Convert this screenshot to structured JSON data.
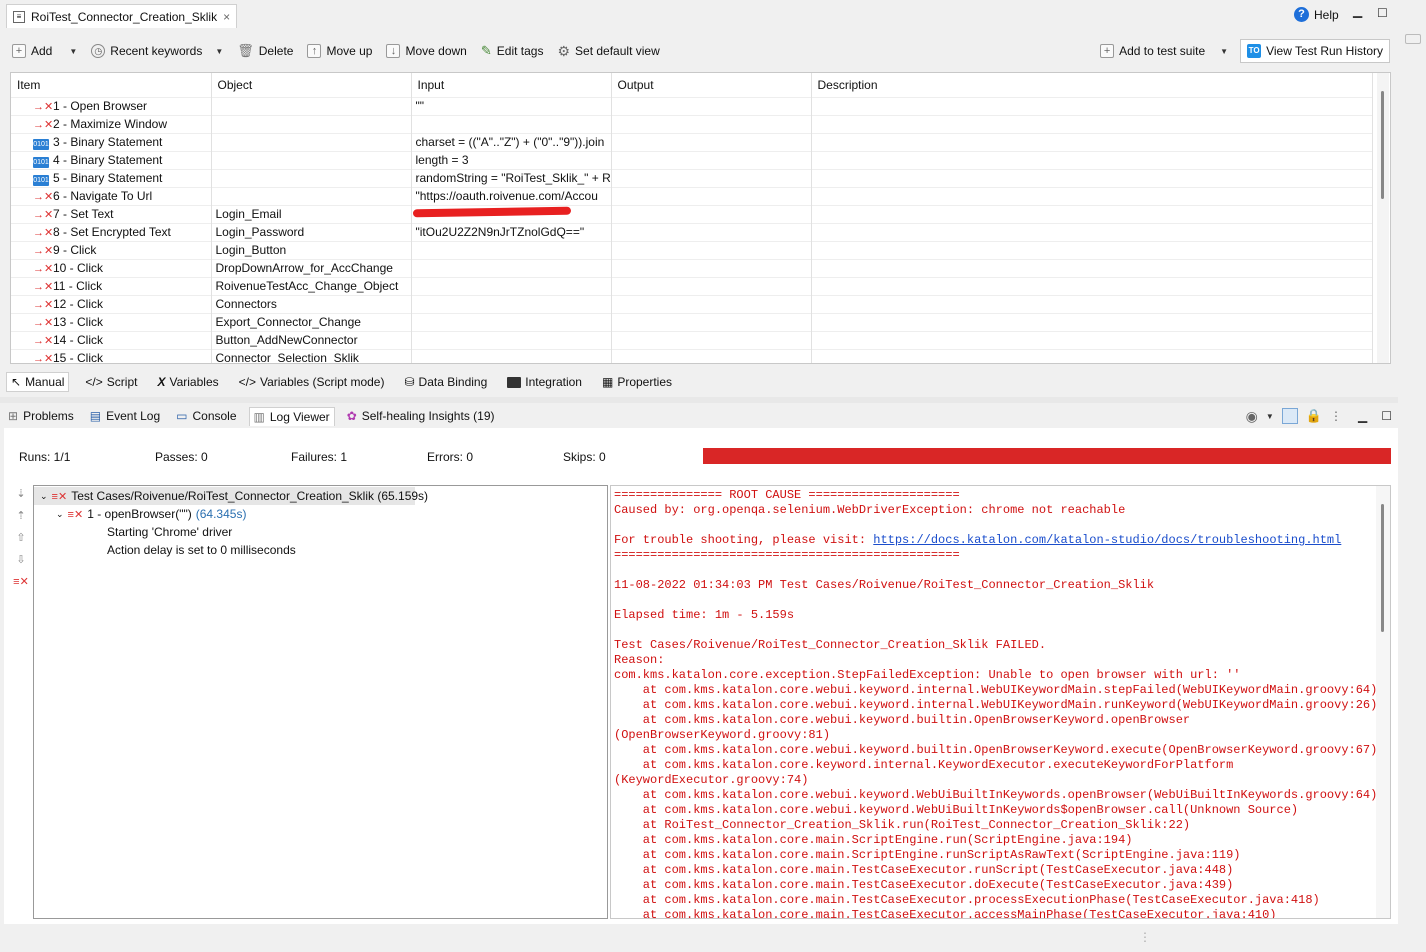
{
  "editor_tab": {
    "title": "RoiTest_Connector_Creation_Sklik",
    "close": "×"
  },
  "help": {
    "label": "Help"
  },
  "toolbar": {
    "add": "Add",
    "recent_keywords": "Recent keywords",
    "delete": "Delete",
    "move_up": "Move up",
    "move_down": "Move down",
    "edit_tags": "Edit tags",
    "set_default_view": "Set default view",
    "add_to_test_suite": "Add to test suite",
    "view_history": "View Test Run History"
  },
  "grid": {
    "headers": {
      "item": "Item",
      "object": "Object",
      "input": "Input",
      "output": "Output",
      "description": "Description"
    },
    "rows": [
      {
        "item": "1 - Open Browser",
        "object": "",
        "input": "\"\"",
        "icon": "x"
      },
      {
        "item": "2 - Maximize Window",
        "object": "",
        "input": "",
        "icon": "x"
      },
      {
        "item": "3 - Binary Statement",
        "object": "",
        "input": "charset = ((\"A\"..\"Z\") + (\"0\"..\"9\")).join",
        "icon": "bin"
      },
      {
        "item": "4 - Binary Statement",
        "object": "",
        "input": "length = 3",
        "icon": "bin"
      },
      {
        "item": "5 - Binary Statement",
        "object": "",
        "input": "randomString = \"RoiTest_Sklik_\" + Ra",
        "icon": "bin"
      },
      {
        "item": "6 - Navigate To Url",
        "object": "",
        "input": "\"https://oauth.roivenue.com/Accou",
        "icon": "x"
      },
      {
        "item": "7 - Set Text",
        "object": "Login_Email",
        "input": "\"",
        "icon": "x"
      },
      {
        "item": "8 - Set Encrypted Text",
        "object": "Login_Password",
        "input": "\"itOu2U2Z2N9nJrTZnolGdQ==\"",
        "icon": "x"
      },
      {
        "item": "9 - Click",
        "object": "Login_Button",
        "input": "",
        "icon": "x"
      },
      {
        "item": "10 - Click",
        "object": "DropDownArrow_for_AccChange",
        "input": "",
        "icon": "x"
      },
      {
        "item": "11 - Click",
        "object": "RoivenueTestAcc_Change_Object",
        "input": "",
        "icon": "x"
      },
      {
        "item": "12 - Click",
        "object": "Connectors",
        "input": "",
        "icon": "x"
      },
      {
        "item": "13 - Click",
        "object": "Export_Connector_Change",
        "input": "",
        "icon": "x"
      },
      {
        "item": "14 - Click",
        "object": "Button_AddNewConnector",
        "input": "",
        "icon": "x"
      },
      {
        "item": "15 - Click",
        "object": "Connector_Selection_Sklik",
        "input": "",
        "icon": "x"
      }
    ]
  },
  "bottom_tabs": [
    "Manual",
    "Script",
    "Variables",
    "Variables (Script mode)",
    "Data Binding",
    "Integration",
    "Properties"
  ],
  "view_tabs": [
    "Problems",
    "Event Log",
    "Console",
    "Log Viewer",
    "Self-healing Insights (19)"
  ],
  "stats": {
    "runs": "Runs: 1/1",
    "passes": "Passes: 0",
    "failures": "Failures: 1",
    "errors": "Errors: 0",
    "skips": "Skips: 0"
  },
  "progress": {
    "failed_fraction": 1.0,
    "color": "#d92626"
  },
  "tree": {
    "root": "Test Cases/Roivenue/RoiTest_Connector_Creation_Sklik (65.159s)",
    "step": "1 - openBrowser(\"\")",
    "step_time": "(64.345s)",
    "logs": [
      "Starting 'Chrome' driver",
      "Action delay is set to 0 milliseconds"
    ]
  },
  "console": {
    "line1": "=============== ROOT CAUSE =====================",
    "line2": "Caused by: org.openqa.selenium.WebDriverException: chrome not reachable",
    "trouble_prefix": "For trouble shooting, please visit: ",
    "trouble_link": "https://docs.katalon.com/katalon-studio/docs/troubleshooting.html",
    "line4": "================================================",
    "line5": "11-08-2022 01:34:03 PM Test Cases/Roivenue/RoiTest_Connector_Creation_Sklik",
    "line6": "Elapsed time: 1m - 5.159s",
    "line7": "Test Cases/Roivenue/RoiTest_Connector_Creation_Sklik FAILED.",
    "line8": "Reason:",
    "trace": "com.kms.katalon.core.exception.StepFailedException: Unable to open browser with url: ''\n    at com.kms.katalon.core.webui.keyword.internal.WebUIKeywordMain.stepFailed(WebUIKeywordMain.groovy:64)\n    at com.kms.katalon.core.webui.keyword.internal.WebUIKeywordMain.runKeyword(WebUIKeywordMain.groovy:26)\n    at com.kms.katalon.core.webui.keyword.builtin.OpenBrowserKeyword.openBrowser\n(OpenBrowserKeyword.groovy:81)\n    at com.kms.katalon.core.webui.keyword.builtin.OpenBrowserKeyword.execute(OpenBrowserKeyword.groovy:67)\n    at com.kms.katalon.core.keyword.internal.KeywordExecutor.executeKeywordForPlatform\n(KeywordExecutor.groovy:74)\n    at com.kms.katalon.core.webui.keyword.WebUiBuiltInKeywords.openBrowser(WebUiBuiltInKeywords.groovy:64)\n    at com.kms.katalon.core.webui.keyword.WebUiBuiltInKeywords$openBrowser.call(Unknown Source)\n    at RoiTest_Connector_Creation_Sklik.run(RoiTest_Connector_Creation_Sklik:22)\n    at com.kms.katalon.core.main.ScriptEngine.run(ScriptEngine.java:194)\n    at com.kms.katalon.core.main.ScriptEngine.runScriptAsRawText(ScriptEngine.java:119)\n    at com.kms.katalon.core.main.TestCaseExecutor.runScript(TestCaseExecutor.java:448)\n    at com.kms.katalon.core.main.TestCaseExecutor.doExecute(TestCaseExecutor.java:439)\n    at com.kms.katalon.core.main.TestCaseExecutor.processExecutionPhase(TestCaseExecutor.java:418)\n    at com.kms.katalon.core.main.TestCaseExecutor.accessMainPhase(TestCaseExecutor.java:410)"
  }
}
